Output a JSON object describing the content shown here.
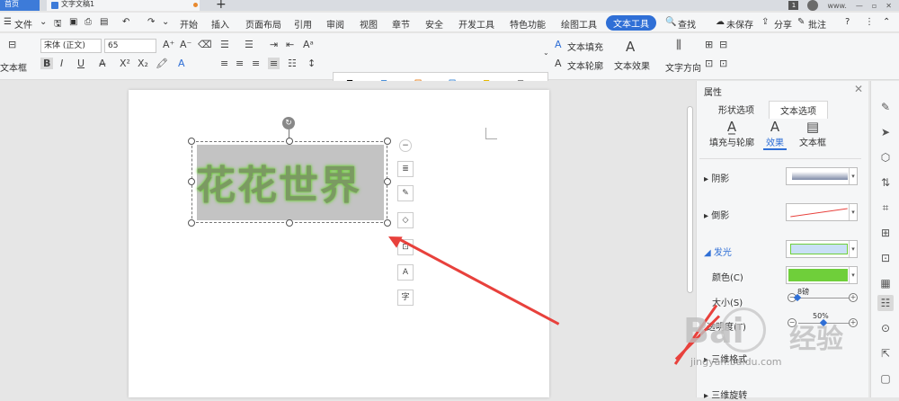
{
  "tabs": {
    "home": "首页",
    "doc": "文字文稿1",
    "add": "+"
  },
  "topbar": {
    "badge": "1",
    "user": "www."
  },
  "menu": {
    "file": "文件",
    "items": [
      "开始",
      "插入",
      "页面布局",
      "引用",
      "审阅",
      "视图",
      "章节",
      "安全",
      "开发工具",
      "特色功能",
      "绘图工具",
      "文本工具"
    ],
    "search": "查找",
    "unsaved": "未保存",
    "share": "分享",
    "comment": "批注"
  },
  "ribbon": {
    "textbox_label": "文本框",
    "font_name": "宋体 (正文)",
    "font_size": "65",
    "bold": "B",
    "italic": "I",
    "underline": "U",
    "wordart_letter": "A",
    "text_fill": "文本填充",
    "text_outline": "文本轮廓",
    "text_effect": "文本效果",
    "text_direction": "文字方向"
  },
  "document": {
    "text": "花花世界"
  },
  "float_toolbar": [
    "−",
    "≣",
    "✎",
    "◇",
    "⊡",
    "A",
    "字"
  ],
  "panel": {
    "title": "属性",
    "tab_shape": "形状选项",
    "tab_text": "文本选项",
    "sub_fill": "填充与轮廓",
    "sub_effect": "效果",
    "sub_textbox": "文本框",
    "shadow": "阴影",
    "reflection": "倒影",
    "glow": "发光",
    "color": "颜色(C)",
    "size": "大小(S)",
    "size_value": "8磅",
    "transparency": "透明度(T)",
    "transparency_value": "50%",
    "three_d_format": "三维格式",
    "three_d_rotate": "三维旋转"
  },
  "colors": {
    "accent": "#2f6fd6",
    "glow": "#6fcf3a",
    "glow_preset": "#c9e0f5",
    "arrow": "#e8413c"
  },
  "watermark": {
    "brand": "Bai",
    "brand2": "经验",
    "url": "jingyan.baidu.com"
  }
}
